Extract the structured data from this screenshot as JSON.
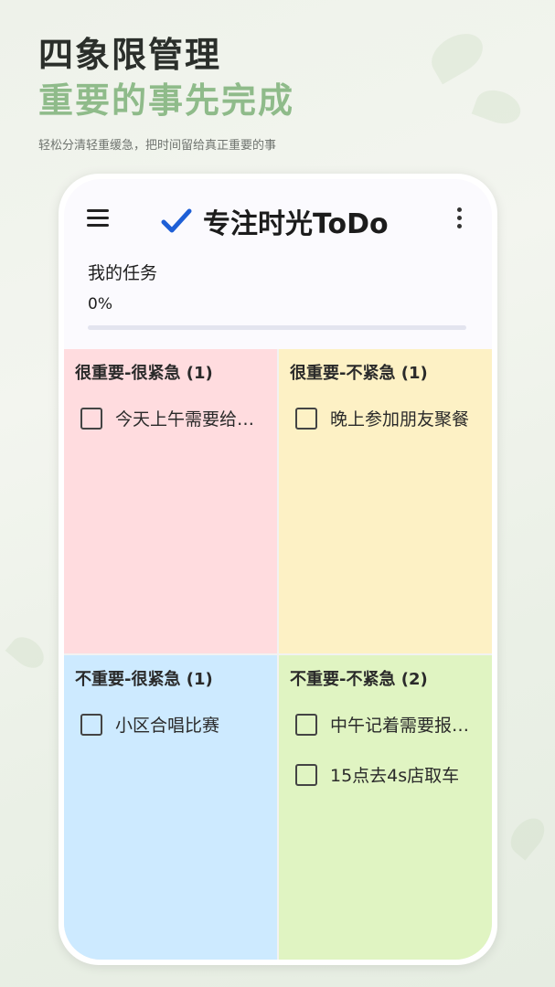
{
  "promo": {
    "headline": "四象限管理",
    "subheadline": "重要的事先完成",
    "tagline": "轻松分清轻重缓急，把时间留给真正重要的事"
  },
  "appbar": {
    "title": "专注时光ToDo",
    "menu_icon": "hamburger-menu-icon",
    "logo_icon": "checkmark-icon",
    "more_icon": "vertical-ellipsis-icon"
  },
  "tasks": {
    "label": "我的任务",
    "progress_text": "0%",
    "progress_value": 0
  },
  "colors": {
    "q1": "#ffdcdf",
    "q2": "#fdf1c5",
    "q3": "#cdeaff",
    "q4": "#e0f4c2",
    "logo_check": "#1e5fd6",
    "headline_green": "#8fbb8a"
  },
  "quadrants": [
    {
      "title": "很重要-很紧急 (1)",
      "items": [
        {
          "text": "今天上午需要给…",
          "checked": false
        }
      ]
    },
    {
      "title": "很重要-不紧急 (1)",
      "items": [
        {
          "text": "晚上参加朋友聚餐",
          "checked": false
        }
      ]
    },
    {
      "title": "不重要-很紧急 (1)",
      "items": [
        {
          "text": "小区合唱比赛",
          "checked": false
        }
      ]
    },
    {
      "title": "不重要-不紧急 (2)",
      "items": [
        {
          "text": "中午记着需要报…",
          "checked": false
        },
        {
          "text": "15点去4s店取车",
          "checked": false
        }
      ]
    }
  ]
}
